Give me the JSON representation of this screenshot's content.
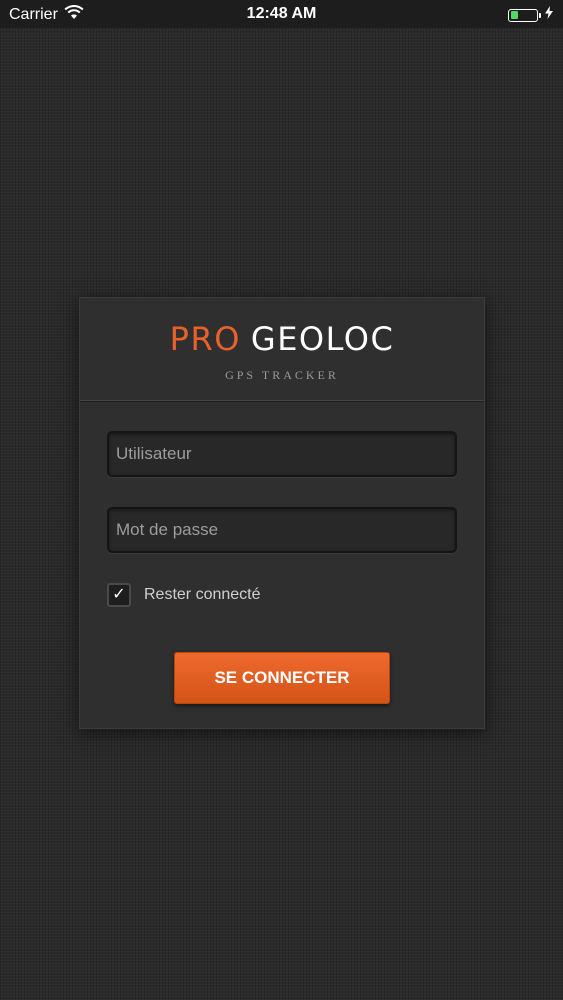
{
  "status_bar": {
    "carrier": "Carrier",
    "time": "12:48 AM",
    "battery_level": 0.3,
    "icons": [
      "wifi-icon",
      "battery-icon",
      "charging-bolt-icon"
    ]
  },
  "login": {
    "brand_pro": "PRO",
    "brand_geoloc": "GEOLOC",
    "tagline": "GPS TRACKER",
    "username_placeholder": "Utilisateur",
    "username_value": "",
    "password_placeholder": "Mot de passe",
    "password_value": "",
    "remember_label": "Rester connecté",
    "remember_checked": true,
    "submit_label": "SE CONNECTER"
  },
  "colors": {
    "accent": "#e8612a",
    "background": "#2b2b2b",
    "card": "#2f2f2f",
    "battery_green": "#4cd964"
  }
}
